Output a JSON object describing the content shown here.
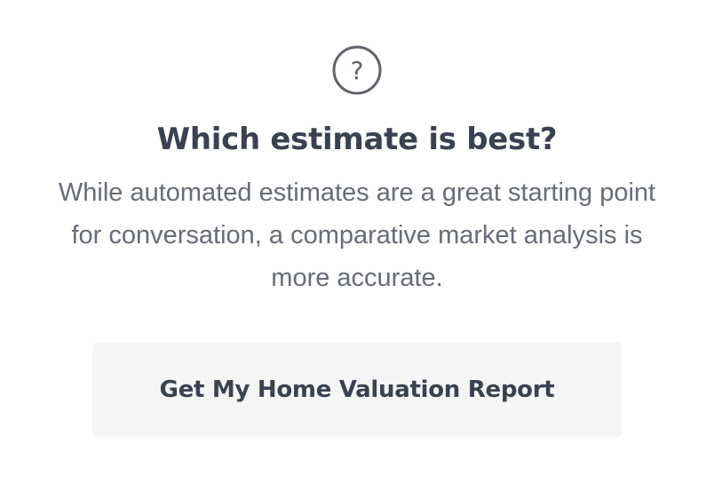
{
  "help_icon": "question-mark-circle",
  "heading": "Which estimate is best?",
  "description": "While automated estimates are a great starting point for conversation, a comparative market analysis is more accurate.",
  "cta_label": "Get My Home Valuation Report",
  "colors": {
    "heading": "#3a4150",
    "body": "#676c76",
    "icon": "#5f636b",
    "button_bg": "#f5f5f6"
  }
}
